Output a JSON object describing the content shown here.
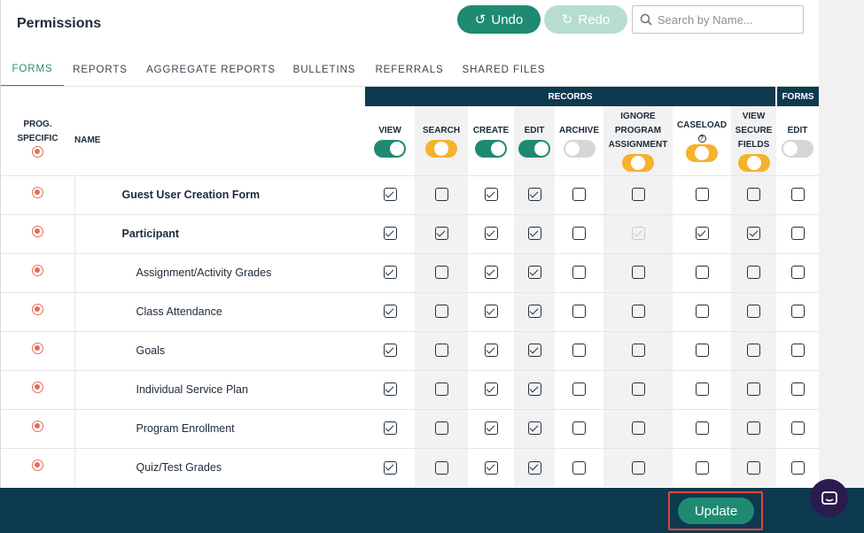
{
  "page": {
    "title": "Permissions"
  },
  "toolbar": {
    "undo_label": "Undo",
    "redo_label": "Redo",
    "search_placeholder": "Search by Name...",
    "undo_icon": "undo-icon",
    "redo_icon": "redo-icon",
    "search_icon": "search-icon"
  },
  "tabs": [
    {
      "label": "FORMS",
      "active": true
    },
    {
      "label": "REPORTS",
      "active": false
    },
    {
      "label": "AGGREGATE REPORTS",
      "active": false
    },
    {
      "label": "BULLETINS",
      "active": false
    },
    {
      "label": "REFERRALS",
      "active": false
    },
    {
      "label": "SHARED FILES",
      "active": false
    }
  ],
  "groups": {
    "records": "RECORDS",
    "forms": "FORMS"
  },
  "headers": {
    "prog_line1": "PROG.",
    "prog_line2": "SPECIFIC",
    "name": "NAME",
    "columns": [
      {
        "lines": [
          "VIEW"
        ],
        "toggle": "on"
      },
      {
        "lines": [
          "SEARCH"
        ],
        "toggle": "partial"
      },
      {
        "lines": [
          "CREATE"
        ],
        "toggle": "on"
      },
      {
        "lines": [
          "EDIT"
        ],
        "toggle": "on"
      },
      {
        "lines": [
          "ARCHIVE"
        ],
        "toggle": "off"
      },
      {
        "lines": [
          "IGNORE",
          "PROGRAM",
          "ASSIGNMENT"
        ],
        "toggle": "partial"
      },
      {
        "lines": [
          "CASELOAD"
        ],
        "toggle": "partial",
        "help": "?"
      },
      {
        "lines": [
          "VIEW",
          "SECURE",
          "FIELDS"
        ],
        "toggle": "partial"
      },
      {
        "lines": [
          "EDIT"
        ],
        "toggle": "off"
      }
    ]
  },
  "rows": [
    {
      "name": "Guest User Creation Form",
      "level": 0,
      "checks": [
        true,
        false,
        true,
        true,
        false,
        false,
        false,
        false,
        false
      ]
    },
    {
      "name": "Participant",
      "level": 0,
      "checks": [
        true,
        true,
        true,
        true,
        false,
        "disabled",
        true,
        true,
        false
      ]
    },
    {
      "name": "Assignment/Activity Grades",
      "level": 1,
      "checks": [
        true,
        false,
        true,
        true,
        false,
        false,
        false,
        false,
        false
      ]
    },
    {
      "name": "Class Attendance",
      "level": 1,
      "checks": [
        true,
        false,
        true,
        true,
        false,
        false,
        false,
        false,
        false
      ]
    },
    {
      "name": "Goals",
      "level": 1,
      "checks": [
        true,
        false,
        true,
        true,
        false,
        false,
        false,
        false,
        false
      ]
    },
    {
      "name": "Individual Service Plan",
      "level": 1,
      "checks": [
        true,
        false,
        true,
        true,
        false,
        false,
        false,
        false,
        false
      ]
    },
    {
      "name": "Program Enrollment",
      "level": 1,
      "checks": [
        true,
        false,
        true,
        true,
        false,
        false,
        false,
        false,
        false
      ]
    },
    {
      "name": "Quiz/Test Grades",
      "level": 1,
      "checks": [
        true,
        false,
        true,
        true,
        false,
        false,
        false,
        false,
        false
      ]
    }
  ],
  "footer": {
    "update_label": "Update"
  },
  "colors": {
    "primary": "#1f8a72",
    "navy": "#0e3a4f",
    "toggle_partial": "#f5b22c",
    "target": "#e46c5b",
    "highlight": "#e0473b"
  }
}
